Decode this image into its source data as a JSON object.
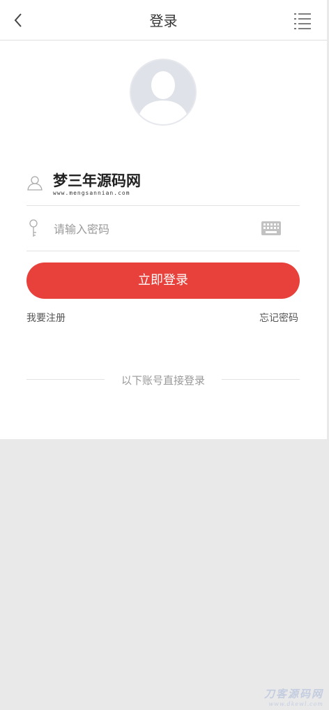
{
  "header": {
    "title": "登录",
    "back_icon": "back-arrow-icon",
    "menu_icon": "list-menu-icon"
  },
  "avatar": {
    "icon": "default-avatar-icon"
  },
  "form": {
    "username_icon": "user-icon",
    "brand_text": "梦三年源码网",
    "brand_url": "www.mengsannian.com",
    "password_icon": "key-icon",
    "password_placeholder": "请输入密码",
    "password_value": "",
    "keyboard_icon": "keyboard-icon"
  },
  "actions": {
    "login_label": "立即登录",
    "register_label": "我要注册",
    "forgot_label": "忘记密码"
  },
  "third_party": {
    "divider_text": "以下账号直接登录"
  },
  "watermark": {
    "main": "刀客源码网",
    "sub": "www.dkewl.com"
  },
  "colors": {
    "accent": "#e8403a",
    "background": "#e9e9e9"
  }
}
